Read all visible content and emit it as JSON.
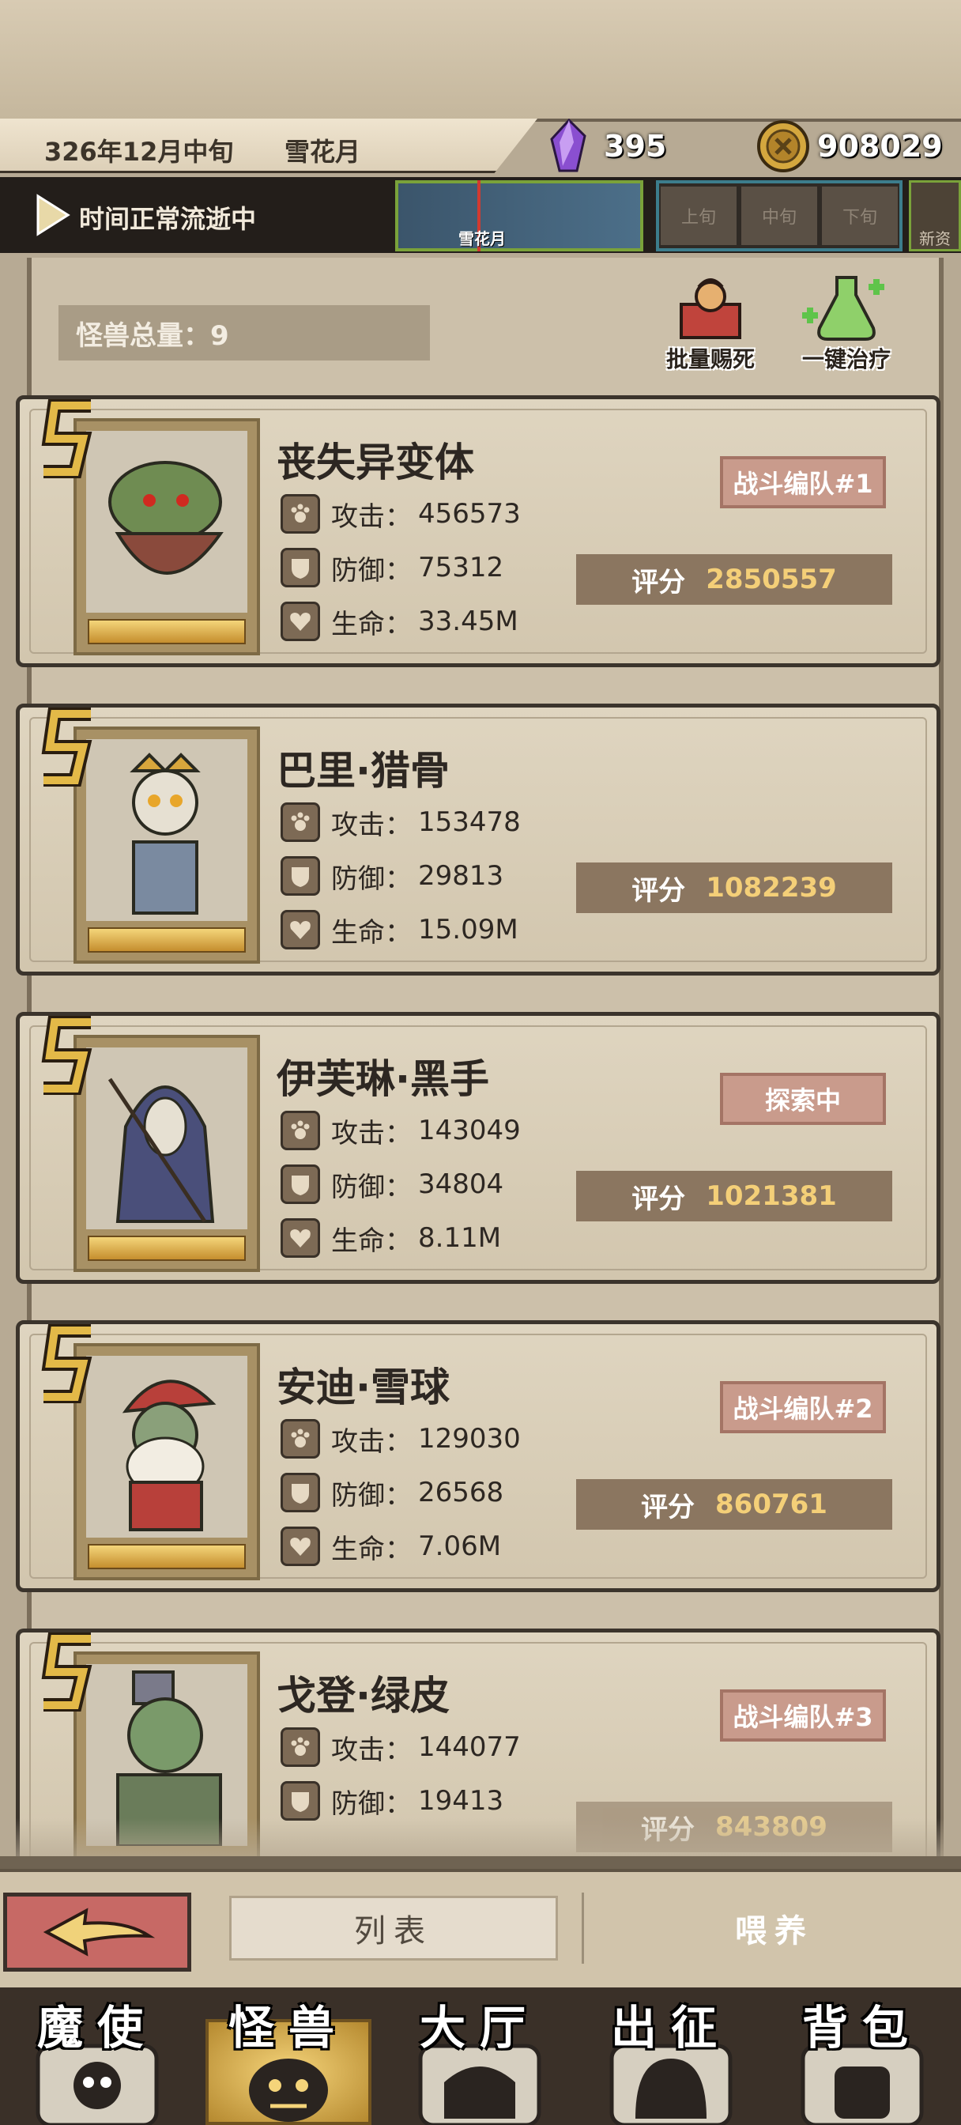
{
  "header": {
    "date": "326年12月中旬",
    "month_name": "雪花月",
    "crystals": "395",
    "coins": "908029",
    "time_status": "时间正常流逝中",
    "timeline_month": "雪花月",
    "periods": [
      "上旬",
      "中旬",
      "下旬"
    ],
    "next_label": "新资"
  },
  "summary": {
    "total": "怪兽总量：9",
    "batch_kill": "批量赐死",
    "heal_all": "一键治疗"
  },
  "stat_labels": {
    "attack": "攻击：",
    "defense": "防御：",
    "hp": "生命：",
    "score": "评分"
  },
  "monsters": [
    {
      "name": "丧失异变体",
      "attack": "456573",
      "defense": "75312",
      "hp": "33.45M",
      "score": "2850557",
      "tag": "战斗编队#1"
    },
    {
      "name": "巴里·猎骨",
      "attack": "153478",
      "defense": "29813",
      "hp": "15.09M",
      "score": "1082239",
      "tag": ""
    },
    {
      "name": "伊芙琳·黑手",
      "attack": "143049",
      "defense": "34804",
      "hp": "8.11M",
      "score": "1021381",
      "tag": "探索中"
    },
    {
      "name": "安迪·雪球",
      "attack": "129030",
      "defense": "26568",
      "hp": "7.06M",
      "score": "860761",
      "tag": "战斗编队#2"
    },
    {
      "name": "戈登·绿皮",
      "attack": "144077",
      "defense": "19413",
      "hp": "",
      "score": "843809",
      "tag": "战斗编队#3"
    }
  ],
  "tabs": {
    "list": "列表",
    "feed": "喂养"
  },
  "nav": [
    "魔使",
    "怪兽",
    "大厅",
    "出征",
    "背包"
  ],
  "colors": {
    "tag_bg": "#c99b8c",
    "score_bg": "#8b7660",
    "score_value": "#f4cf78",
    "card_bg": "#d8cdb7"
  }
}
